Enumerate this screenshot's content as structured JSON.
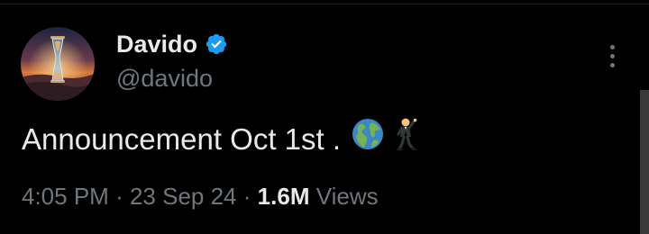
{
  "author": {
    "display_name": "Davido",
    "handle": "@davido",
    "verified": true,
    "verified_color": "#1d9bf0",
    "avatar_icon": "hourglass-desert-avatar"
  },
  "tweet": {
    "text": "Announcement Oct 1st .",
    "emojis": [
      "globe-americas-emoji",
      "man-dancing-emoji"
    ]
  },
  "meta": {
    "time": "4:05 PM",
    "separator": "·",
    "date": "23 Sep 24",
    "views_count": "1.6M",
    "views_label": "Views"
  },
  "menu": {
    "icon": "more-vertical-icon"
  },
  "colors": {
    "background": "#000000",
    "primary_text": "#e7e9ea",
    "secondary_text": "#71767b"
  }
}
